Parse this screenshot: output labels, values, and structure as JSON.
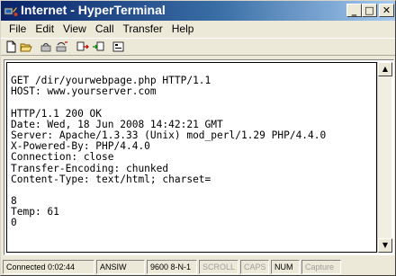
{
  "window": {
    "title": "Internet - HyperTerminal",
    "controls": {
      "minimize": "_",
      "maximize": "□",
      "close": "✕"
    }
  },
  "menu": {
    "items": [
      "File",
      "Edit",
      "View",
      "Call",
      "Transfer",
      "Help"
    ]
  },
  "toolbar": {
    "buttons": [
      "new-icon",
      "open-icon",
      "connect-icon",
      "disconnect-icon",
      "send-icon",
      "receive-icon",
      "properties-icon"
    ]
  },
  "terminal": {
    "lines": [
      "GET /dir/yourwebpage.php HTTP/1.1",
      "HOST: www.yourserver.com",
      "",
      "HTTP/1.1 200 OK",
      "Date: Wed, 18 Jun 2008 14:42:21 GMT",
      "Server: Apache/1.3.33 (Unix) mod_perl/1.29 PHP/4.4.0",
      "X-Powered-By: PHP/4.4.0",
      "Connection: close",
      "Transfer-Encoding: chunked",
      "Content-Type: text/html; charset=",
      "",
      "8",
      "Temp: 61",
      "0"
    ]
  },
  "status": {
    "connection": "Connected 0:02:44",
    "emulation": "ANSIW",
    "settings": "9600 8-N-1",
    "scroll": "SCROLL",
    "caps": "CAPS",
    "num": "NUM",
    "capture": "Capture"
  },
  "colors": {
    "title_start": "#0a246a",
    "title_end": "#a6caf0",
    "chrome": "#ece9d8"
  }
}
